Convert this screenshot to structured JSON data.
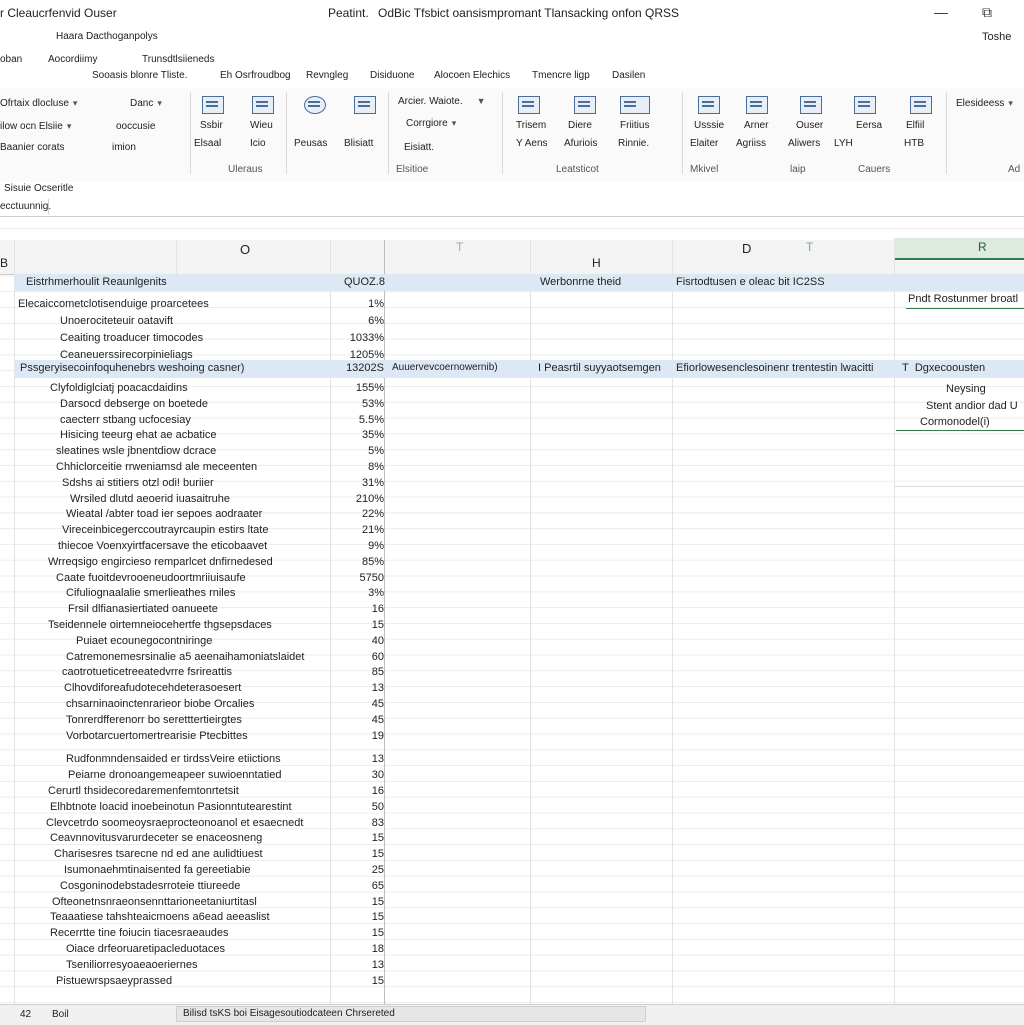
{
  "window": {
    "left_title": "r Cleaucrfenvid Ouser",
    "center_title": "Peatint.",
    "doc_title": "OdBic Tfsbict oansismpromant Tlansacking onfon QRSS",
    "right_text": "Toshe",
    "minimize_glyph": "—",
    "restore_glyph": "⧉",
    "subtitle": "Haara Dacthoganpolys"
  },
  "menu": {
    "row1": [
      "oban",
      "Aocordiimy",
      "Trunsdtlsiieneds"
    ],
    "row2": [
      "Sooasis blonre Tliste.",
      "Eh Osrfroudbog",
      "Revngleg",
      "Disiduone",
      "Alocoen Elechics",
      "Tmencre ligp",
      "Dasilen"
    ]
  },
  "ribbon": {
    "clipboard": {
      "rows": [
        "Ofrtaix dlocluse",
        "ilow ocn Elsiie",
        "Baanier  corats"
      ],
      "rows_right": [
        "Danc",
        "ooccusie",
        "imion"
      ]
    },
    "btns1": [
      {
        "top": "Ssbir",
        "bot": "Elsaal"
      },
      {
        "top": "Wieu",
        "bot": "Icio"
      },
      {
        "top": "Peusas",
        "bot": "Peusas"
      },
      {
        "top": "Blisiatt",
        "bot": "Blisiatt"
      }
    ],
    "group1": "Uleraus",
    "styles": {
      "a": "Arcier. Waiote.",
      "b": "Corrgiore",
      "c": "Eisiatt."
    },
    "group2": "Elsitioe",
    "btns2": [
      {
        "top": "Trisem",
        "bot": "Y Aens"
      },
      {
        "top": "Diere",
        "bot": "Afuriois"
      },
      {
        "top": "Friitius",
        "bot": "Rinnie."
      }
    ],
    "group3": "Leatsticot",
    "btns3": [
      {
        "top": "Usssie",
        "bot": "Elaiter"
      },
      {
        "top": "Arner",
        "bot": "Agriiss"
      },
      {
        "top": "Ouser",
        "bot": "Aliwers"
      },
      {
        "top": "Eersa",
        "bot": "LYH"
      },
      {
        "top": "Elfiil",
        "bot": "HTB"
      }
    ],
    "groups_b": [
      "Mkivel",
      "laip",
      "Cauers"
    ],
    "right_label": "Elesideess",
    "right_small": "Ad"
  },
  "formula": {
    "namebox": "Sisuie Ocseritle",
    "cell_ref": "ecctuunnig."
  },
  "columns": {
    "left_b": "B",
    "c_o": "O",
    "c_t1": "T",
    "c_h": "H",
    "c_d": "D",
    "c_t2": "T",
    "c_r": "R"
  },
  "header_row": {
    "label": "Eistrhmerhoulit Reaunlgenits",
    "value": "QUOZ.8",
    "h_label": "Werbonrne theid",
    "d_label": "Fisrtodtusen e oleac bit IC2SS",
    "r_label": "Pndt Rostunmer broatl"
  },
  "section_row": {
    "label": "Pssgeryisecoinfoquhenebrs weshoing casner)",
    "value": "13202S",
    "c2": "Auuervevcoernowernib)",
    "c3": "I Peasrtil suyyaotsemgen",
    "c4": "Efiorlowesenclesoinenr trentestin lwacitti",
    "r_text": "Dgxecoousten",
    "r_sub1": "Neysing",
    "r_sub2": "Stent andior dad U",
    "r_sub3": "Cormonodel(i)"
  },
  "rows_top": [
    {
      "label": "Elecaiccometclotisenduige proarcetees",
      "value": "1%"
    },
    {
      "label": "Unoerociteteuir oatavift",
      "value": "6%"
    },
    {
      "label": "Ceaiting troaducer timocodes",
      "value": "1033%"
    },
    {
      "label": "Ceaneuerssirecorpinieliags",
      "value": "1205%"
    }
  ],
  "rows": [
    {
      "label": "Clyfoldiglciatj poacacdaidins",
      "value": "155%"
    },
    {
      "label": "Darsocd debserge on boetede",
      "value": "53%"
    },
    {
      "label": "caecterr stbang ucfocesiay",
      "value": "5.5%"
    },
    {
      "label": "Hisicing teeurg ehat ae acbatice",
      "value": "35%"
    },
    {
      "label": "sleatines wsle jbnentdiow dcrace",
      "value": "5%"
    },
    {
      "label": "Chhiclorceitie rrweniamsd ale meceenten",
      "value": "8%"
    },
    {
      "label": "Sdshs ai stitiers otzl odi! buriier",
      "value": "31%"
    },
    {
      "label": "Wrsiled dlutd aeoerid iuasaitruhe",
      "value": "210%"
    },
    {
      "label": "Wieatal /abter toad ier sepoes aodraater",
      "value": "22%"
    },
    {
      "label": "Vireceinbicegerccoutrayrcaupin estirs ltate",
      "value": "21%"
    },
    {
      "label": "thiecoe Voenxyirtfacersave the eticobaavet",
      "value": "9%"
    },
    {
      "label": "Wrreqsigo engircieso remparlcet dnfirnedesed",
      "value": "85%"
    },
    {
      "label": "Caate fuoitdevrooeneudoortmriiuisaufe",
      "value": "5750"
    },
    {
      "label": "Cifuliognaalalie smerlieathes rniles",
      "value": "3%"
    },
    {
      "label": "Frsil dlfianasiertiated oanueete",
      "value": "16"
    },
    {
      "label": "Tseidennele oirtemneiocehertfe thgsepsdaces",
      "value": "15"
    },
    {
      "label": "Puiaet ecounegocontniringe",
      "value": "40"
    },
    {
      "label": "Catremonemesrsinalie a5 aeenaihamoniatslaidet",
      "value": "60"
    },
    {
      "label": "caotrotueticetreeatedvrre fsrireattis",
      "value": "85"
    },
    {
      "label": "Clhovdiforeafudotecehdeterasoesert",
      "value": "13"
    },
    {
      "label": "chsarninaoinctenrarieor biobe Orcalies",
      "value": "45"
    },
    {
      "label": "Tonrerdfferenorr bo seretttertieirgtes",
      "value": "45"
    },
    {
      "label": "Vorbotarcuertomertrearisie Ptecbittes",
      "value": "19"
    },
    {
      "label": "Rudfonmndensaided er tirdssVeire etiictions",
      "value": "13"
    },
    {
      "label": "Peiarne dronoangemeapeer suwioenntatied",
      "value": "30"
    },
    {
      "label": "Cerurtl thsidecoredaremenfemtonrtetsit",
      "value": "16"
    },
    {
      "label": "Elhbtnote loacid inoebeinotun Pasionntutearestint",
      "value": "50"
    },
    {
      "label": "Clevcetrdo soomeoysraeprocteonoanol et esaecnedt",
      "value": "83"
    },
    {
      "label": "Ceavnnovitusvarurdeceter se enaceosneng",
      "value": "15"
    },
    {
      "label": "Charisesres tsarecne nd ed ane aulidtiuest",
      "value": "15"
    },
    {
      "label": "Isumonaehmtinaisented fa gereetiabie",
      "value": "25"
    },
    {
      "label": "Cosgoninodebstadesrroteie ttiureede",
      "value": "65"
    },
    {
      "label": "Ofteonetnsnraeonsennttarioneetaniurtitasl",
      "value": "15"
    },
    {
      "label": "Teaaatiese tahshteaicmoens a6ead aeeaslist",
      "value": "15"
    },
    {
      "label": "Recerrtte tine foiucin tiacesraeaudes",
      "value": "15"
    },
    {
      "label": "Oiace drfeoruaretipacleduotaces",
      "value": "18"
    },
    {
      "label": "Tseniliorresyoaeaoeriernes",
      "value": "13"
    },
    {
      "label": "Pistuewrspsaeyprassed",
      "value": "15"
    }
  ],
  "status": {
    "left": "42",
    "sheet": "Boil",
    "center": "Bilisd tsKS boi Eisagesoutiodcateen Chrsereted"
  }
}
